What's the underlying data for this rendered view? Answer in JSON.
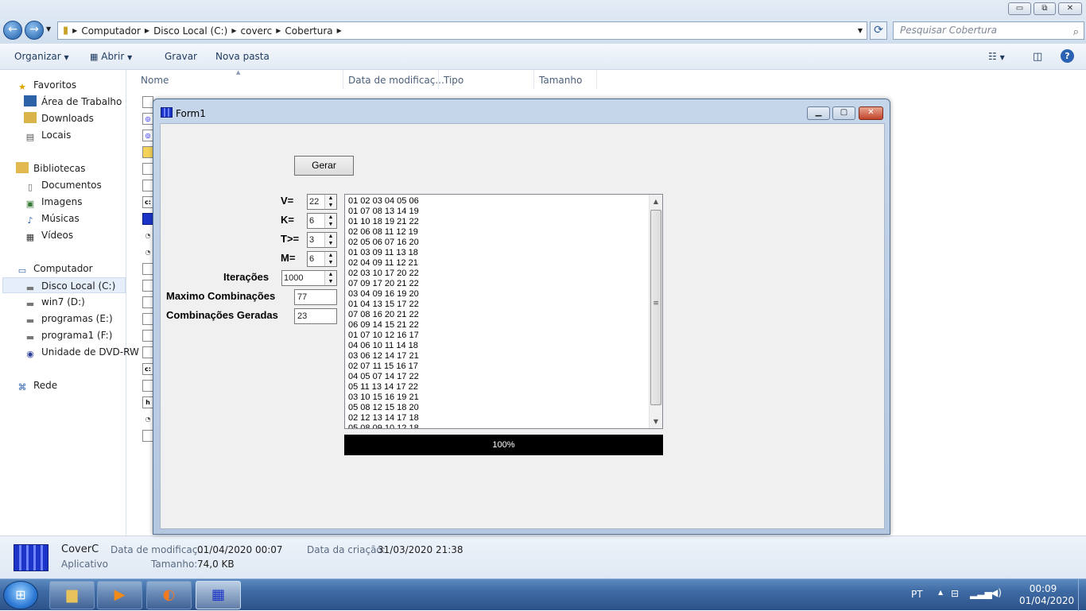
{
  "explorer": {
    "caption_buttons": {
      "minimize": "▭",
      "maximize": "⧉",
      "close": "✕"
    },
    "address": {
      "segments": [
        "Computador",
        "Disco Local (C:)",
        "coverc",
        "Cobertura"
      ],
      "search_placeholder": "Pesquisar Cobertura"
    },
    "toolbar": {
      "organizar": "Organizar",
      "abrir": "Abrir",
      "gravar": "Gravar",
      "nova_pasta": "Nova pasta"
    },
    "nav": {
      "favoritos": "Favoritos",
      "area_de_trabalho": "Área de Trabalho",
      "downloads": "Downloads",
      "locais": "Locais",
      "bibliotecas": "Bibliotecas",
      "documentos": "Documentos",
      "imagens": "Imagens",
      "musicas": "Músicas",
      "videos": "Vídeos",
      "computador": "Computador",
      "disco_local": "Disco Local (C:)",
      "win7": "win7 (D:)",
      "programas": "programas (E:)",
      "programa1": "programa1 (F:)",
      "dvd": "Unidade de DVD-RW",
      "rede": "Rede"
    },
    "columns": {
      "nome": "Nome",
      "data": "Data de modificaç...",
      "tipo": "Tipo",
      "tamanho": "Tamanho"
    },
    "details": {
      "name": "CoverC",
      "type": "Aplicativo",
      "modified_label": "Data de modificaç...",
      "modified_value": "01/04/2020 00:07",
      "created_label": "Data da criação:",
      "created_value": "31/03/2020 21:38",
      "size_label": "Tamanho:",
      "size_value": "74,0 KB"
    }
  },
  "form1": {
    "title": "Form1",
    "gerar_label": "Gerar",
    "v_label": "V=",
    "v_value": "22",
    "k_label": "K=",
    "k_value": "6",
    "t_label": "T>=",
    "t_value": "3",
    "m_label": "M=",
    "m_value": "6",
    "iteracoes_label": "Iterações",
    "iteracoes_value": "1000",
    "maximo_label": "Maximo Combinações",
    "maximo_value": "77",
    "geradas_label": "Combinações Geradas",
    "geradas_value": "23",
    "combinations": [
      "01 02 03 04 05 06",
      "01 07 08 13 14 19",
      "01 10 18 19 21 22",
      "02 06 08 11 12 19",
      "02 05 06 07 16 20",
      "01 03 09 11 13 18",
      "02 04 09 11 12 21",
      "02 03 10 17 20 22",
      "07 09 17 20 21 22",
      "03 04 09 16 19 20",
      "01 04 13 15 17 22",
      "07 08 16 20 21 22",
      "06 09 14 15 21 22",
      "01 07 10 12 16 17",
      "04 06 10 11 14 18",
      "03 06 12 14 17 21",
      "02 07 11 15 16 17",
      "04 05 07 14 17 22",
      "05 11 13 14 17 22",
      "03 10 15 16 19 21",
      "05 08 12 15 18 20",
      "02 12 13 14 17 18",
      "05 08 09 10 12 18"
    ],
    "progress_fraction": 1.0,
    "progress_text": "100%"
  },
  "taskbar": {
    "language": "PT",
    "time": "00:09",
    "date": "01/04/2020"
  }
}
